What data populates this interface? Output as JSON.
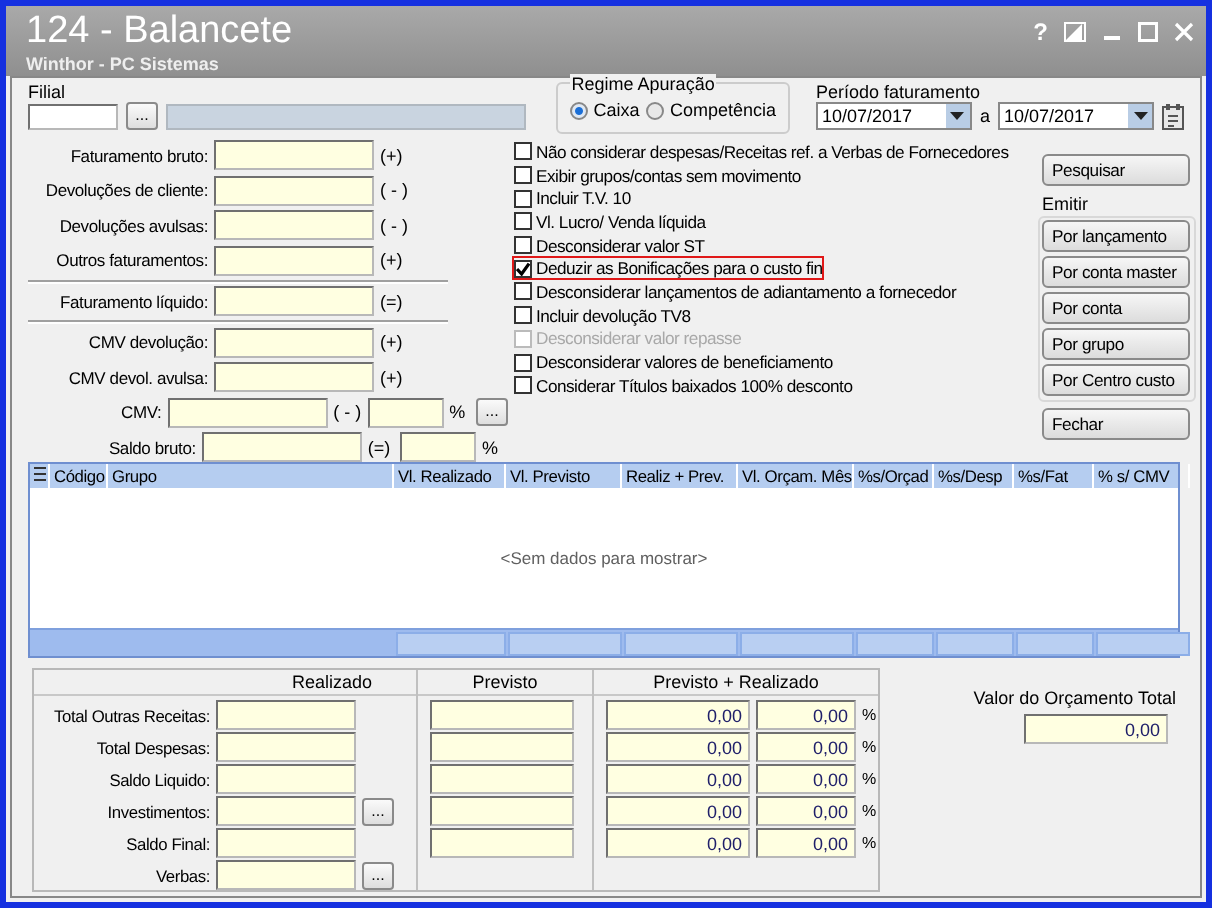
{
  "window": {
    "title": "124 - Balancete",
    "subtitle": "Winthor - PC Sistemas",
    "help": "?"
  },
  "filial": {
    "label": "Filial",
    "button": "..."
  },
  "totals": [
    {
      "kind": "value",
      "label": "Faturamento bruto:",
      "sign": "(+)"
    },
    {
      "kind": "value",
      "label": "Devoluções de cliente:",
      "sign": "( - )"
    },
    {
      "kind": "value",
      "label": "Devoluções avulsas:",
      "sign": "( - )"
    },
    {
      "kind": "value",
      "label": "Outros faturamentos:",
      "sign": "(+)"
    },
    {
      "kind": "total",
      "label": "Faturamento líquido:",
      "sign": "(=)"
    },
    {
      "kind": "value",
      "label": "CMV devolução:",
      "sign": "(+)"
    },
    {
      "kind": "value",
      "label": "CMV devol. avulsa:",
      "sign": "(+)"
    },
    {
      "kind": "percent_button",
      "label": "CMV:",
      "sign": "( - )",
      "percent": "%",
      "button": "..."
    },
    {
      "kind": "percent",
      "label": "Saldo bruto:",
      "sign": "(=)",
      "percent": "%"
    }
  ],
  "regime": {
    "label": "Regime Apuração",
    "options": [
      {
        "label": "Caixa",
        "selected": true
      },
      {
        "label": "Competência",
        "selected": false
      }
    ]
  },
  "periodo": {
    "label": "Período faturamento",
    "from": "10/07/2017",
    "separator": "a",
    "to": "10/07/2017"
  },
  "options": [
    {
      "label": "Não considerar despesas/Receitas ref. a Verbas de Fornecedores",
      "checked": false,
      "disabled": false,
      "highlighted": false
    },
    {
      "label": "Exibir grupos/contas sem movimento",
      "checked": false,
      "disabled": false,
      "highlighted": false
    },
    {
      "label": "Incluir T.V. 10",
      "checked": false,
      "disabled": false,
      "highlighted": false
    },
    {
      "label": "Vl. Lucro/ Venda líquida",
      "checked": false,
      "disabled": false,
      "highlighted": false
    },
    {
      "label": "Desconsiderar valor ST",
      "checked": false,
      "disabled": false,
      "highlighted": false
    },
    {
      "label": "Deduzir as Bonificações para o custo fin",
      "checked": true,
      "disabled": false,
      "highlighted": true
    },
    {
      "label": "Desconsiderar lançamentos de adiantamento a fornecedor",
      "checked": false,
      "disabled": false,
      "highlighted": false
    },
    {
      "label": "Incluir devolução TV8",
      "checked": false,
      "disabled": false,
      "highlighted": false
    },
    {
      "label": "Desconsiderar valor repasse",
      "checked": false,
      "disabled": true,
      "highlighted": false
    },
    {
      "label": "Desconsiderar valores de beneficiamento",
      "checked": false,
      "disabled": false,
      "highlighted": false
    },
    {
      "label": "Considerar Títulos baixados 100% desconto",
      "checked": false,
      "disabled": false,
      "highlighted": false
    }
  ],
  "actions": {
    "search": "Pesquisar",
    "emit_label": "Emitir",
    "emit_buttons": [
      "Por lançamento",
      "Por conta master",
      "Por conta",
      "Por grupo",
      "Por Centro custo"
    ],
    "close": "Fechar"
  },
  "grid": {
    "columns": [
      {
        "label": "Código",
        "footer_cell": false
      },
      {
        "label": "Grupo",
        "footer_cell": false
      },
      {
        "label": "Vl. Realizado",
        "footer_cell": true
      },
      {
        "label": "Vl. Previsto",
        "footer_cell": true
      },
      {
        "label": "Realiz + Prev.",
        "footer_cell": true
      },
      {
        "label": "Vl. Orçam. Mês",
        "footer_cell": true
      },
      {
        "label": "%s/Orçad",
        "footer_cell": true
      },
      {
        "label": "%s/Desp",
        "footer_cell": true
      },
      {
        "label": "%s/Fat",
        "footer_cell": true
      },
      {
        "label": "% s/ CMV",
        "footer_cell": true
      }
    ],
    "empty_text": "<Sem dados para mostrar>"
  },
  "summary": {
    "headers": [
      "Realizado",
      "Previsto",
      "Previsto + Realizado"
    ],
    "rows": [
      {
        "kind": "full",
        "label": "Total Outras Receitas:",
        "total": "0,00",
        "percent": "0,00",
        "percent_sign": "%"
      },
      {
        "kind": "full",
        "label": "Total Despesas:",
        "total": "0,00",
        "percent": "0,00",
        "percent_sign": "%"
      },
      {
        "kind": "full",
        "label": "Saldo Liquido:",
        "total": "0,00",
        "percent": "0,00",
        "percent_sign": "%"
      },
      {
        "kind": "full",
        "label": "Investimentos:",
        "button": "...",
        "total": "0,00",
        "percent": "0,00",
        "percent_sign": "%"
      },
      {
        "kind": "full",
        "label": "Saldo Final:",
        "total": "0,00",
        "percent": "0,00",
        "percent_sign": "%"
      },
      {
        "kind": "realizado_only",
        "label": "Verbas:",
        "button": "..."
      }
    ]
  },
  "budget": {
    "label": "Valor do Orçamento Total",
    "value": "0,00"
  }
}
